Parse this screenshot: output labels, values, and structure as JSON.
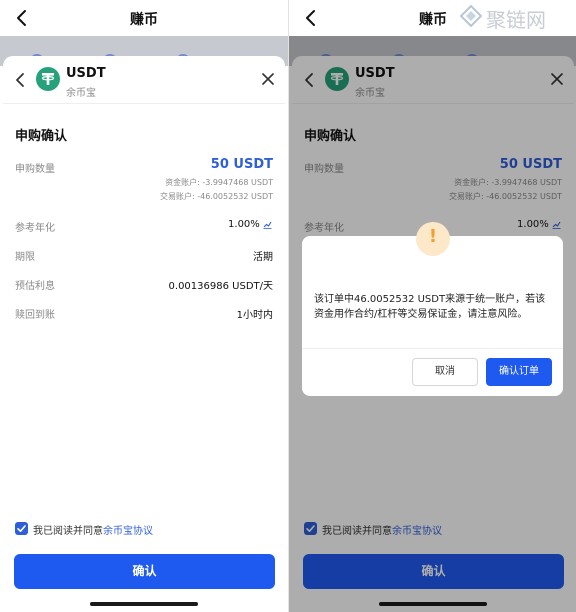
{
  "header": {
    "title": "赚币"
  },
  "sheet": {
    "coin_name": "USDT",
    "coin_sub": "余币宝",
    "section_title": "申购确认",
    "rows": {
      "amount_label": "申购数量",
      "amount_value": "50 USDT",
      "funding_line": "资金账户: -3.9947468 USDT",
      "trading_line": "交易账户: -46.0052532 USDT",
      "apr_label": "参考年化",
      "apr_value": "1.00%",
      "term_label": "期限",
      "term_value": "活期",
      "interest_label": "预估利息",
      "interest_value": "0.00136986 USDT/天",
      "redeem_label": "赎回到账",
      "redeem_value": "1小时内"
    },
    "agree_text": "我已阅读并同意",
    "agree_link": "余币宝协议",
    "confirm_label": "确认"
  },
  "dialog": {
    "warning_mark": "!",
    "message": "该订单中46.0052532 USDT来源于统一账户，若该资金用作合约/杠杆等交易保证金，请注意风险。",
    "cancel_label": "取消",
    "ok_label": "确认订单"
  },
  "watermark": {
    "text": "聚链网"
  },
  "colors": {
    "accent": "#1f5af0",
    "link": "#2f5fd8",
    "usdt": "#26a17b",
    "warning": "#f2a033"
  }
}
